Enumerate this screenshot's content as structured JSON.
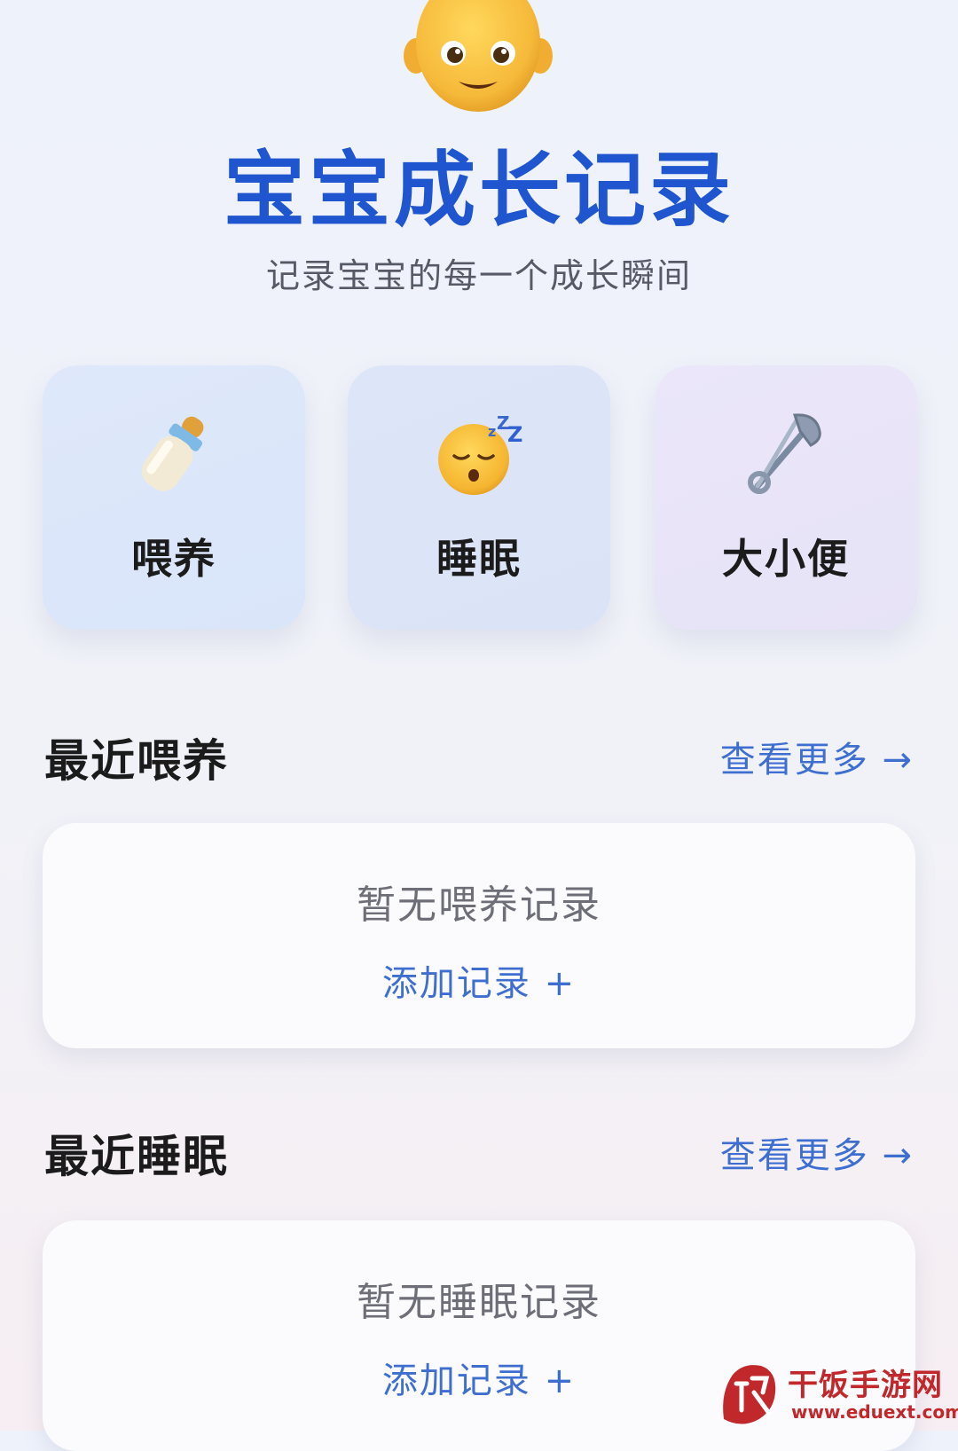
{
  "header": {
    "icon": "baby-face-icon",
    "title": "宝宝成长记录",
    "subtitle": "记录宝宝的每一个成长瞬间"
  },
  "categories": [
    {
      "label": "喂养",
      "icon": "baby-bottle-icon"
    },
    {
      "label": "睡眠",
      "icon": "sleeping-face-icon"
    },
    {
      "label": "大小便",
      "icon": "safety-pin-icon"
    }
  ],
  "sections": [
    {
      "title": "最近喂养",
      "view_more": "查看更多 →",
      "empty_text": "暂无喂养记录",
      "add_label": "添加记录 +"
    },
    {
      "title": "最近睡眠",
      "view_more": "查看更多 →",
      "empty_text": "暂无睡眠记录",
      "add_label": "添加记录 +"
    }
  ],
  "watermark": {
    "name": "干饭手游网",
    "url": "www.eduext.com"
  },
  "colors": {
    "title": "#1f56cf",
    "link": "#3e6fd0",
    "watermark": "#c0282b"
  }
}
